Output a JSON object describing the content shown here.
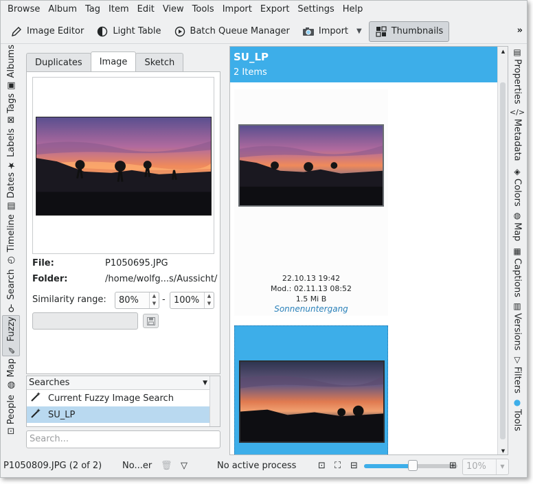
{
  "menu": [
    "Browse",
    "Album",
    "Tag",
    "Item",
    "Edit",
    "View",
    "Tools",
    "Import",
    "Export",
    "Settings",
    "Help"
  ],
  "toolbar": {
    "image_editor": "Image Editor",
    "light_table": "Light Table",
    "batch_queue": "Batch Queue Manager",
    "import": "Import",
    "thumbnails": "Thumbnails",
    "overflow": "»"
  },
  "left_tabs": [
    "Albums",
    "Tags",
    "Labels",
    "Dates",
    "Timeline",
    "Search",
    "Fuzzy",
    "Map",
    "People"
  ],
  "right_tabs": [
    "Properties",
    "Metadata",
    "Colors",
    "Map",
    "Captions",
    "Versions",
    "Filters",
    "Tools"
  ],
  "fuzzy": {
    "tabs": [
      "Duplicates",
      "Image",
      "Sketch"
    ],
    "file_label": "File:",
    "file_value": "P1050695.JPG",
    "folder_label": "Folder:",
    "folder_value": "/home/wolfg...s/Aussicht/",
    "similarity_label": "Similarity range:",
    "sim_min": "80%",
    "sim_max": "100%",
    "sim_dash": "-",
    "searches_header": "Searches",
    "searches": [
      "Current Fuzzy Image Search",
      "SU_LP"
    ],
    "filter_placeholder": "Search..."
  },
  "album": {
    "title": "SU_LP",
    "count": "2 Items",
    "item1": {
      "date": "22.10.13 19:42",
      "modified": "Mod.: 02.11.13 08:52",
      "size": "1.5 Mi B",
      "tag": "Sonnenuntergang"
    }
  },
  "status": {
    "filename": "P1050809.JPG (2 of 2)",
    "filter": "No...er",
    "process": "No active process",
    "zoom": "10%",
    "zoom_fraction": 0.52
  },
  "colors": {
    "accent": "#3daee9",
    "selection": "#b9d9f0",
    "window_bg": "#eff0f1"
  }
}
